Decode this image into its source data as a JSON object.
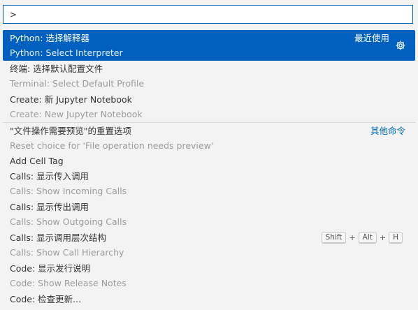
{
  "search": {
    "value": ">"
  },
  "items": [
    {
      "title": "Python: 选择解释器",
      "subtitle": "Python: Select Interpreter",
      "right_label": "最近使用"
    },
    {
      "title": "终端: 选择默认配置文件",
      "subtitle": "Terminal: Select Default Profile"
    },
    {
      "title": "Create: 新 Jupyter Notebook",
      "subtitle": "Create: New Jupyter Notebook"
    },
    {
      "title": "\"文件操作需要预览\"的重置选项",
      "subtitle": "Reset choice for 'File operation needs preview'",
      "right_link": "其他命令"
    },
    {
      "title": "Add Cell Tag"
    },
    {
      "title": "Calls: 显示传入调用",
      "subtitle": "Calls: Show Incoming Calls"
    },
    {
      "title": "Calls: 显示传出调用",
      "subtitle": "Calls: Show Outgoing Calls"
    },
    {
      "title": "Calls: 显示调用层次结构",
      "subtitle": "Calls: Show Call Hierarchy",
      "keybinding": [
        "Shift",
        "+",
        "Alt",
        "+",
        "H"
      ]
    },
    {
      "title": "Code: 显示发行说明",
      "subtitle": "Code: Show Release Notes"
    },
    {
      "title": "Code: 检查更新..."
    }
  ],
  "colors": {
    "selection": "#0060c0",
    "accent_border": "#0063b1",
    "link": "#006ab1"
  }
}
